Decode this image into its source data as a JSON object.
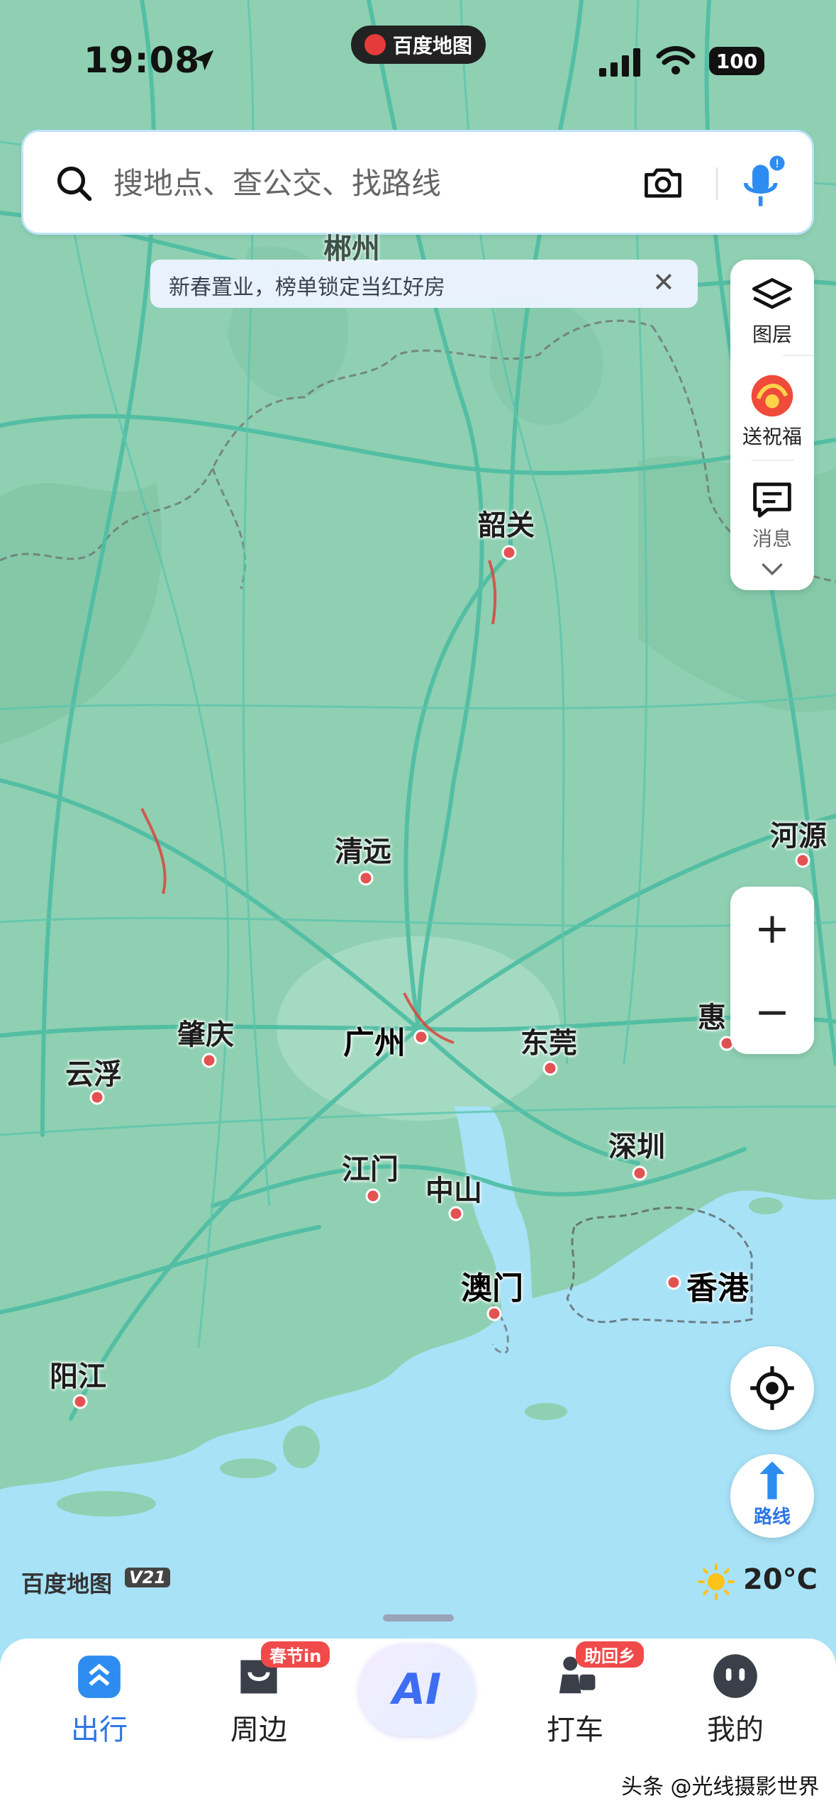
{
  "status_bar": {
    "time": "19:08",
    "brand": "百度地图",
    "battery": "100"
  },
  "search": {
    "placeholder": "搜地点、查公交、找路线"
  },
  "promo": {
    "text": "新春置业，榜单锁定当红好房",
    "close": "✕"
  },
  "side_panel": {
    "layers": "图层",
    "blessing": "送祝福",
    "messages": "消息"
  },
  "zoom": {
    "in": "+",
    "out": "−"
  },
  "route_button": {
    "label": "路线"
  },
  "map": {
    "cities": [
      "郴州",
      "韶关",
      "清远",
      "河源",
      "肇庆",
      "广州",
      "东莞",
      "惠",
      "云浮",
      "深圳",
      "江门",
      "中山",
      "澳门",
      "香港",
      "阳江"
    ],
    "logo": "百度地图",
    "version": "V21",
    "weather": "20°C"
  },
  "bottom_nav": {
    "items": [
      {
        "label": "出行"
      },
      {
        "label": "周边",
        "badge": "春节in"
      },
      {
        "label": "AI"
      },
      {
        "label": "打车",
        "badge": "助回乡"
      },
      {
        "label": "我的"
      }
    ]
  },
  "watermark": "头条 @光线摄影世界",
  "colors": {
    "accent": "#2b74e6",
    "land": "#8fd0b2",
    "sea": "#a8e2f7",
    "road": "#4dbda2",
    "city_dot": "#e35252"
  }
}
